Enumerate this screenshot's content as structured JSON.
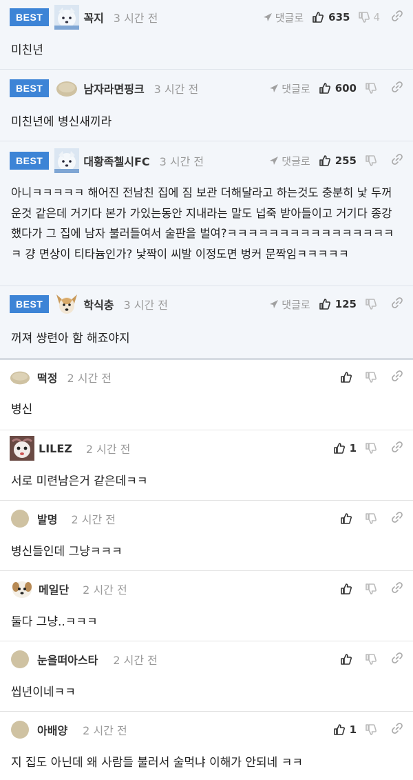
{
  "best_badge": "BEST",
  "reply_label": "댓글로",
  "best_comments": [
    {
      "nick": "꼭지",
      "time": "3 시간 전",
      "up": "635",
      "down": "4",
      "text": "미친년"
    },
    {
      "nick": "남자라면핑크",
      "time": "3 시간 전",
      "up": "600",
      "down": "",
      "text": "미친년에 병신새끼라"
    },
    {
      "nick": "대황족첼시FC",
      "time": "3 시간 전",
      "up": "255",
      "down": "",
      "text": "아니ㅋㅋㅋㅋㅋ 해어진 전남친 집에 짐 보관 더해달라고 하는것도 충분히 낯 두꺼운것 같은데 거기다 본가 가있는동안 지내라는 말도 넙죽 받아들이고 거기다 종강 했다가 그 집에 남자 불러들여서 술판을 벌여?ㅋㅋㅋㅋㅋㅋㅋㅋㅋㅋㅋㅋㅋㅋㅋㅋㅋ 걍 면상이 티타늄인가? 낯짝이 씨발 이정도면 벙커 문짝임ㅋㅋㅋㅋㅋ"
    },
    {
      "nick": "학식충",
      "time": "3 시간 전",
      "up": "125",
      "down": "",
      "text": "꺼져 썅련아 함 해죠야지"
    }
  ],
  "comments": [
    {
      "nick": "떡정",
      "time": "2 시간 전",
      "up": "",
      "text": "병신"
    },
    {
      "nick": "LILEZ",
      "time": "2 시간 전",
      "up": "1",
      "text": "서로 미련남은거 같은데ㅋㅋ"
    },
    {
      "nick": "발명",
      "time": "2 시간 전",
      "up": "",
      "text": "병신들인데 그냥ㅋㅋㅋ"
    },
    {
      "nick": "메일단",
      "time": "2 시간 전",
      "up": "",
      "text": "둘다 그냥..ㅋㅋㅋ"
    },
    {
      "nick": "눈을떠아스타",
      "time": "2 시간 전",
      "up": "",
      "text": "씹년이네ㅋㅋ"
    },
    {
      "nick": "아배양",
      "time": "2 시간 전",
      "up": "1",
      "text": "지 집도 아닌데 왜 사람들 불러서 술먹냐 이해가 안되네 ㅋㅋ"
    }
  ],
  "colors": {
    "badge": "#3d84d6",
    "best_bg": "#f3f6fa",
    "time": "#9a9a9a"
  }
}
